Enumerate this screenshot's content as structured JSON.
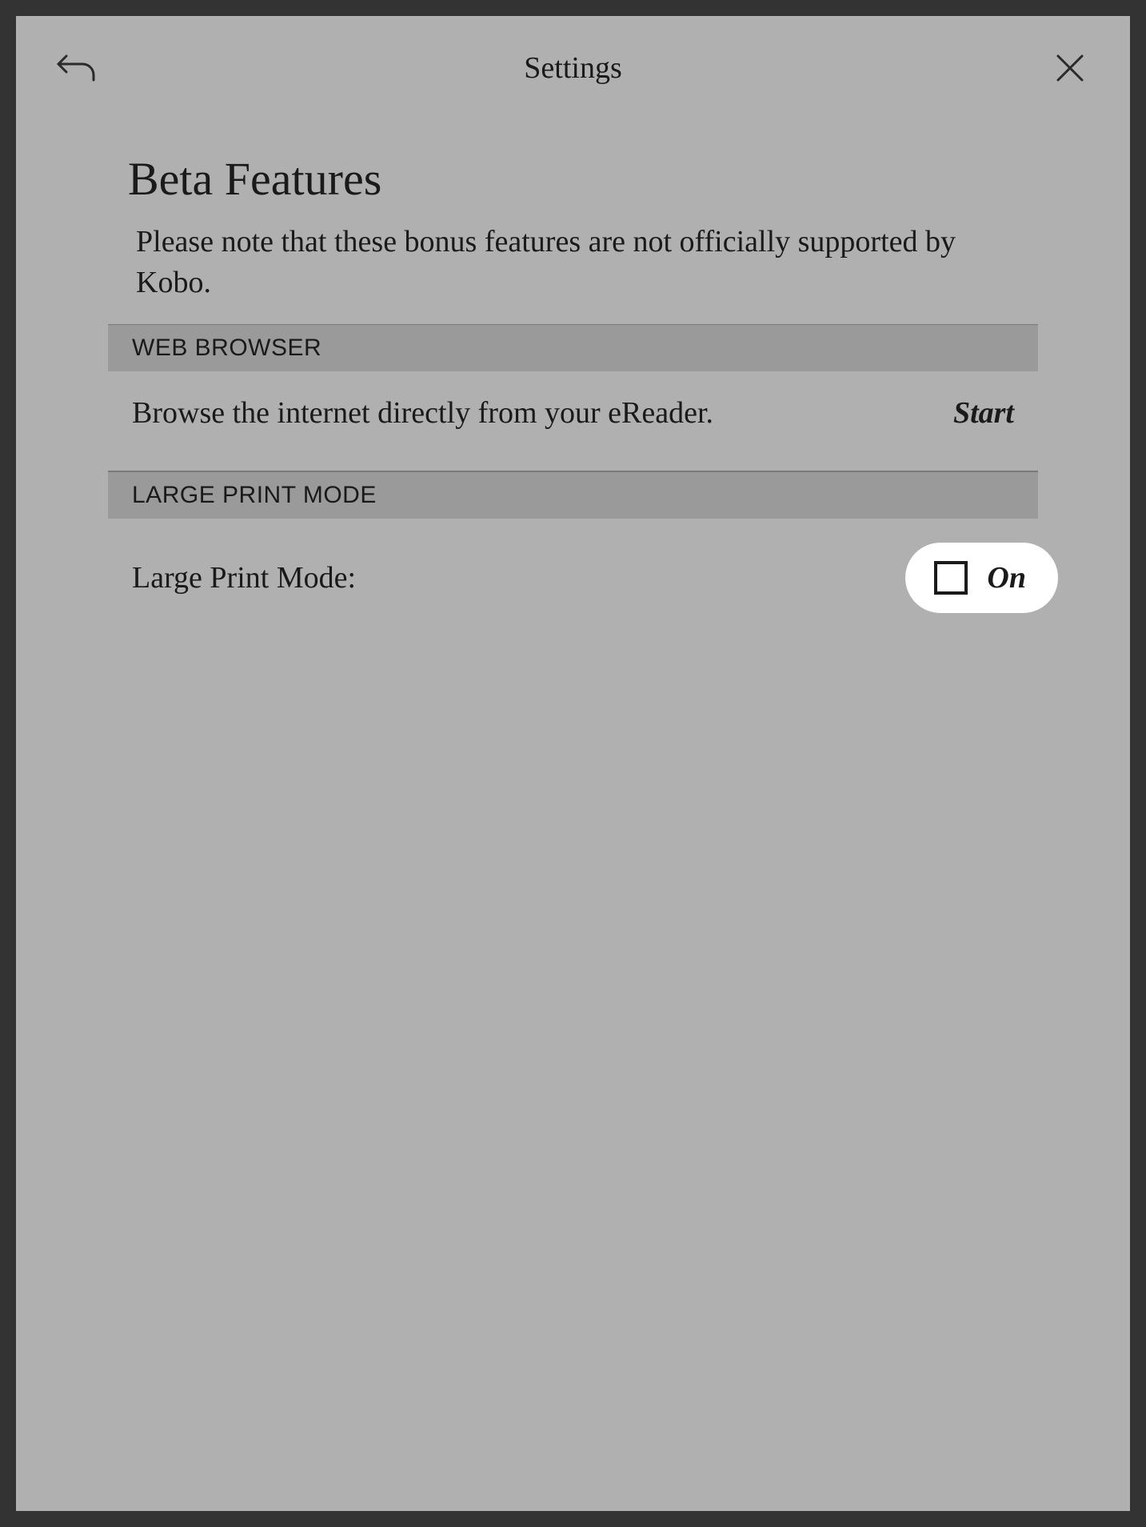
{
  "header": {
    "title": "Settings"
  },
  "page": {
    "title": "Beta Features",
    "description": "Please note that these bonus features are not officially supported by Kobo."
  },
  "sections": {
    "webBrowser": {
      "header": "WEB BROWSER",
      "description": "Browse the internet directly from your eReader.",
      "action": "Start"
    },
    "largePrint": {
      "header": "LARGE PRINT MODE",
      "label": "Large Print Mode:",
      "toggleText": "On"
    }
  }
}
